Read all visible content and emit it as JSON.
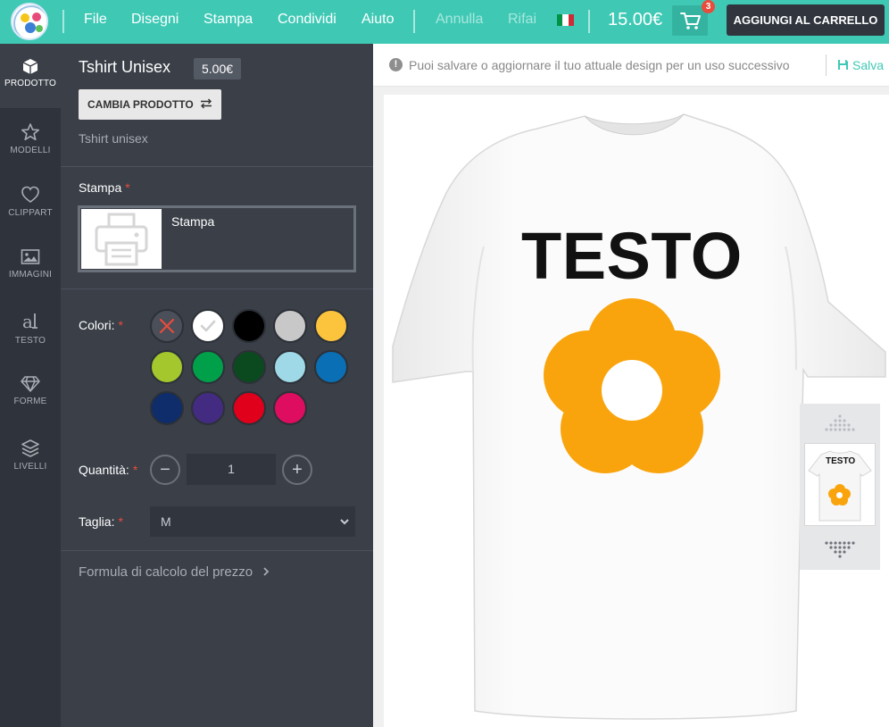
{
  "app": {
    "logo_icon": "shop-logo-icon"
  },
  "menu": {
    "file": "File",
    "designs": "Disegni",
    "print": "Stampa",
    "share": "Condividi",
    "help": "Aiuto",
    "undo": "Annulla",
    "redo": "Rifai"
  },
  "header": {
    "total_price": "15.00€",
    "cart_count": "3",
    "add_to_cart": "AGGIUNGI AL CARRELLO"
  },
  "sidebar": {
    "items": [
      {
        "label": "PRODOTTO",
        "icon": "box-icon"
      },
      {
        "label": "MODELLI",
        "icon": "star-icon"
      },
      {
        "label": "CLIPPART",
        "icon": "heart-icon"
      },
      {
        "label": "IMMAGINI",
        "icon": "image-icon"
      },
      {
        "label": "TESTO",
        "icon": "text-icon"
      },
      {
        "label": "FORME",
        "icon": "diamond-icon"
      },
      {
        "label": "LIVELLI",
        "icon": "layers-icon"
      }
    ]
  },
  "product": {
    "title": "Tshirt Unisex",
    "price": "5.00€",
    "change_label": "CAMBIA PRODOTTO",
    "subtitle": "Tshirt unisex"
  },
  "print": {
    "label": "Stampa",
    "required": "*",
    "option_name": "Stampa"
  },
  "colors": {
    "label": "Colori:",
    "required": "*",
    "swatches": [
      "none",
      "#ffffff",
      "#000000",
      "#c8c8c8",
      "#fcc43d",
      "#a3c72d",
      "#00a04a",
      "#0b4a1f",
      "#9fd8e6",
      "#0a6fb5",
      "#0e2d6a",
      "#432b82",
      "#e1001b",
      "#de0d5f"
    ],
    "selected": "#ffffff"
  },
  "quantity": {
    "label": "Quantità:",
    "required": "*",
    "value": "1",
    "minus": "−",
    "plus": "+"
  },
  "size": {
    "label": "Taglia:",
    "required": "*",
    "value": "M"
  },
  "formula_link": "Formula di calcolo del prezzo",
  "info": {
    "message": "Puoi salvare o aggiornare il tuo attuale design per un uso successivo",
    "save": "Salva"
  },
  "design": {
    "text": "TESTO",
    "shirt_color": "#ffffff",
    "flower_color": "#f9a40c"
  },
  "thumbnail": {
    "text": "TESTO"
  }
}
